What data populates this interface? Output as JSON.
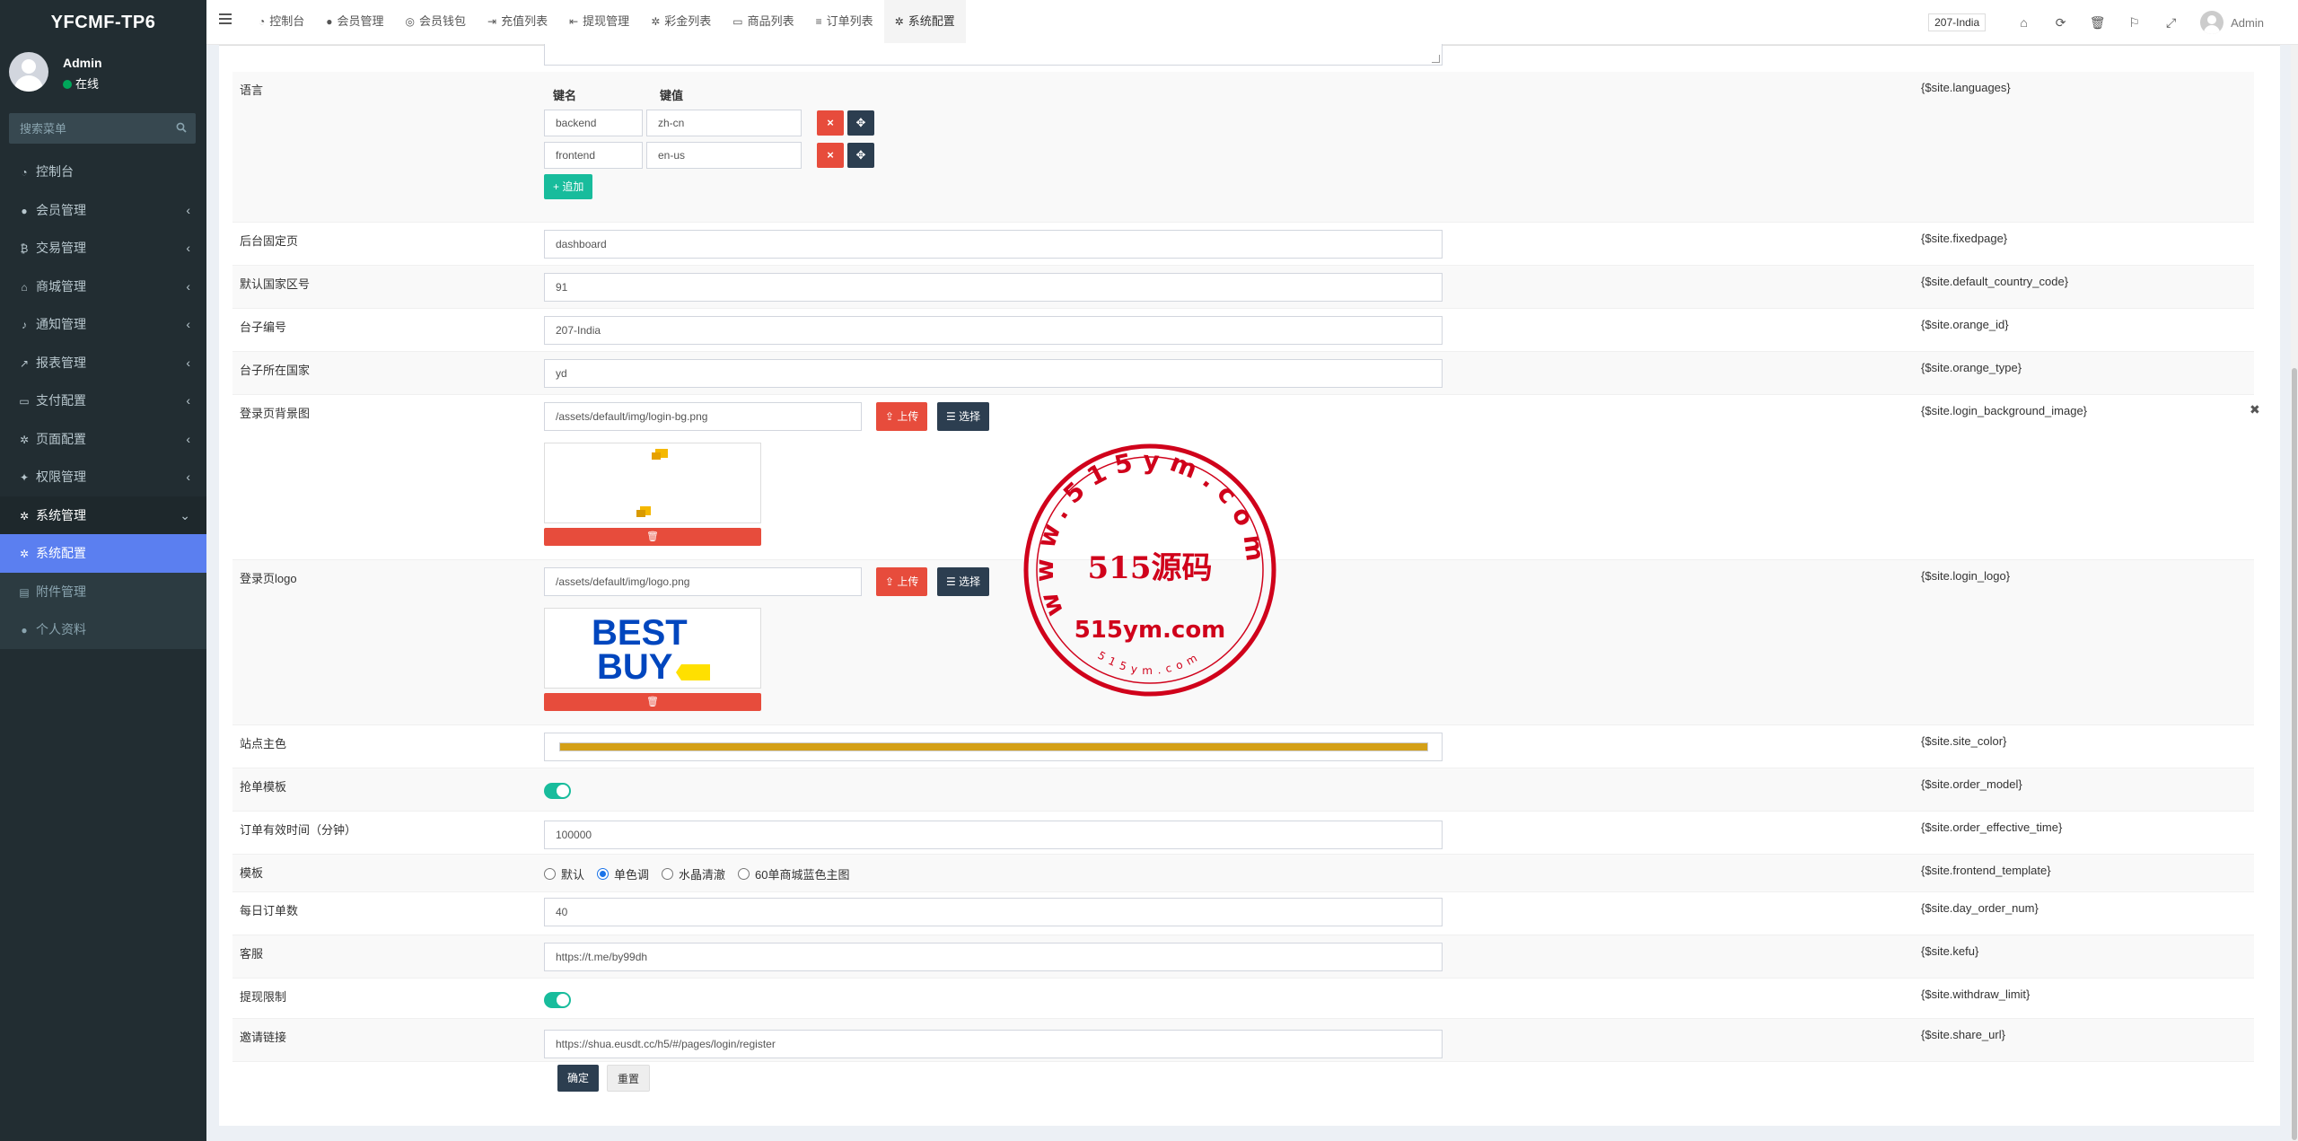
{
  "app": {
    "title": "YFCMF-TP6"
  },
  "user": {
    "name": "Admin",
    "status": "在线"
  },
  "search": {
    "placeholder": "搜索菜单"
  },
  "sidebar": {
    "items": [
      {
        "label": "控制台",
        "icon": "dashboard-icon",
        "glyph": "◔"
      },
      {
        "label": "会员管理",
        "icon": "users-icon",
        "glyph": "●"
      },
      {
        "label": "交易管理",
        "icon": "bitcoin-icon",
        "glyph": "₿"
      },
      {
        "label": "商城管理",
        "icon": "home-icon",
        "glyph": "⌂"
      },
      {
        "label": "通知管理",
        "icon": "bell-icon",
        "glyph": "♪"
      },
      {
        "label": "报表管理",
        "icon": "chart-icon",
        "glyph": "↗"
      },
      {
        "label": "支付配置",
        "icon": "card-icon",
        "glyph": "▭"
      },
      {
        "label": "页面配置",
        "icon": "cog-icon",
        "glyph": "✲"
      },
      {
        "label": "权限管理",
        "icon": "group-icon",
        "glyph": "✦"
      },
      {
        "label": "系统管理",
        "icon": "cogs-icon",
        "glyph": "✲"
      },
      {
        "label": "系统配置",
        "icon": "cog-icon",
        "glyph": "✲"
      },
      {
        "label": "附件管理",
        "icon": "file-icon",
        "glyph": "▤"
      },
      {
        "label": "个人资料",
        "icon": "user-icon",
        "glyph": "●"
      }
    ]
  },
  "topbar": {
    "tabs": [
      {
        "label": "控制台",
        "glyph": "◔"
      },
      {
        "label": "会员管理",
        "glyph": "●"
      },
      {
        "label": "会员钱包",
        "glyph": "◎"
      },
      {
        "label": "充值列表",
        "glyph": "⇥"
      },
      {
        "label": "提现管理",
        "glyph": "⇤"
      },
      {
        "label": "彩金列表",
        "glyph": "✲"
      },
      {
        "label": "商品列表",
        "glyph": "▭"
      },
      {
        "label": "订单列表",
        "glyph": "≡"
      },
      {
        "label": "系统配置",
        "glyph": "✲"
      }
    ],
    "site": "207-India",
    "admin": "Admin"
  },
  "form": {
    "languages": {
      "label": "语言",
      "key_header": "键名",
      "value_header": "键值",
      "rows": [
        {
          "key": "backend",
          "value": "zh-cn"
        },
        {
          "key": "frontend",
          "value": "en-us"
        }
      ],
      "add_label": "+ 追加",
      "var": "{$site.languages}"
    },
    "fixedpage": {
      "label": "后台固定页",
      "value": "dashboard",
      "var": "{$site.fixedpage}"
    },
    "country_code": {
      "label": "默认国家区号",
      "value": "91",
      "var": "{$site.default_country_code}"
    },
    "orange_id": {
      "label": "台子编号",
      "value": "207-India",
      "var": "{$site.orange_id}"
    },
    "orange_type": {
      "label": "台子所在国家",
      "value": "yd",
      "var": "{$site.orange_type}"
    },
    "login_bg": {
      "label": "登录页背景图",
      "value": "/assets/default/img/login-bg.png",
      "upload": "上传",
      "select": "选择",
      "var": "{$site.login_background_image}"
    },
    "login_logo": {
      "label": "登录页logo",
      "value": "/assets/default/img/logo.png",
      "upload": "上传",
      "select": "选择",
      "var": "{$site.login_logo}",
      "logo_line1": "BEST",
      "logo_line2": "BUY"
    },
    "site_color": {
      "label": "站点主色",
      "color": "#d4a017",
      "var": "{$site.site_color}"
    },
    "order_model": {
      "label": "抢单模板",
      "on": true,
      "var": "{$site.order_model}"
    },
    "order_time": {
      "label": "订单有效时间（分钟）",
      "value": "100000",
      "var": "{$site.order_effective_time}"
    },
    "template": {
      "label": "模板",
      "options": [
        "默认",
        "单色调",
        "水晶清澈",
        "60单商城蓝色主图"
      ],
      "selected": "单色调",
      "var": "{$site.frontend_template}"
    },
    "day_order": {
      "label": "每日订单数",
      "value": "40",
      "var": "{$site.day_order_num}"
    },
    "kefu": {
      "label": "客服",
      "value": "https://t.me/by99dh",
      "var": "{$site.kefu}"
    },
    "withdraw_limit": {
      "label": "提现限制",
      "on": true,
      "var": "{$site.withdraw_limit}"
    },
    "share_url": {
      "label": "邀请链接",
      "value": "https://shua.eusdt.cc/h5/#/pages/login/register",
      "var": "{$site.share_url}"
    },
    "submit": "确定",
    "reset": "重置"
  },
  "watermark": {
    "ring": "www.515ym.com",
    "center": "515源码",
    "url": "515ym.com",
    "small": "515ym.com",
    "color": "#d0021b"
  }
}
